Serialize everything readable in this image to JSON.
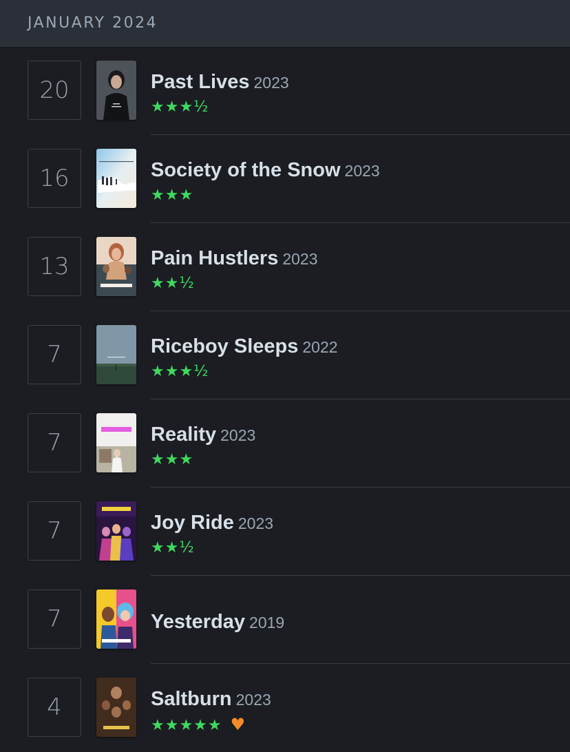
{
  "header": {
    "title": "JANUARY 2024"
  },
  "colors": {
    "rating_green": "#40d860",
    "like_orange": "#f28c2b",
    "background": "#1b1d22",
    "header_bg": "#2b2f37"
  },
  "entries": [
    {
      "day": "20",
      "title": "Past Lives",
      "year": "2023",
      "rating_text": "★★★½",
      "rating_value": 3.5,
      "liked": false,
      "heart": ""
    },
    {
      "day": "16",
      "title": "Society of the Snow",
      "year": "2023",
      "rating_text": "★★★",
      "rating_value": 3,
      "liked": false,
      "heart": ""
    },
    {
      "day": "13",
      "title": "Pain Hustlers",
      "year": "2023",
      "rating_text": "★★½",
      "rating_value": 2.5,
      "liked": false,
      "heart": ""
    },
    {
      "day": "7",
      "title": "Riceboy Sleeps",
      "year": "2022",
      "rating_text": "★★★½",
      "rating_value": 3.5,
      "liked": false,
      "heart": ""
    },
    {
      "day": "7",
      "title": "Reality",
      "year": "2023",
      "rating_text": "★★★",
      "rating_value": 3,
      "liked": false,
      "heart": ""
    },
    {
      "day": "7",
      "title": "Joy Ride",
      "year": "2023",
      "rating_text": "★★½",
      "rating_value": 2.5,
      "liked": false,
      "heart": ""
    },
    {
      "day": "7",
      "title": "Yesterday",
      "year": "2019",
      "rating_text": "",
      "rating_value": null,
      "liked": false,
      "heart": ""
    },
    {
      "day": "4",
      "title": "Saltburn",
      "year": "2023",
      "rating_text": "★★★★★",
      "rating_value": 5,
      "liked": true,
      "heart": "♥"
    }
  ]
}
